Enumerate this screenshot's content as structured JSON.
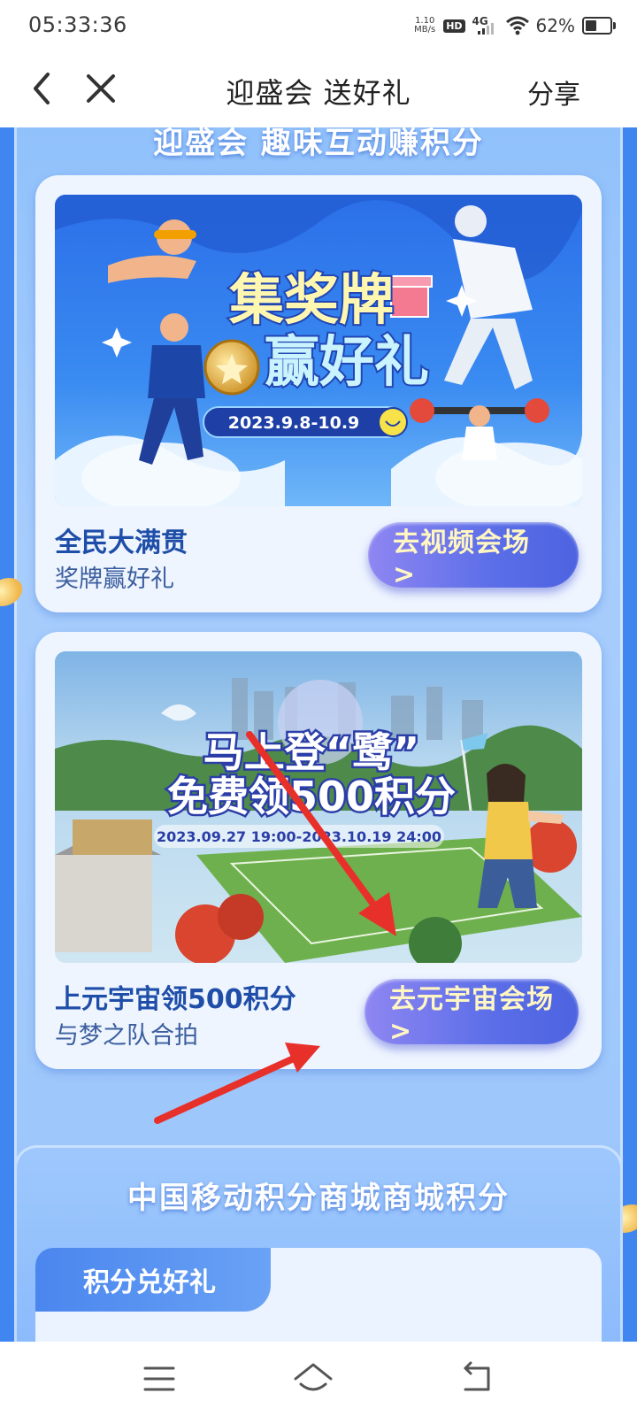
{
  "status_bar": {
    "time": "05:33:36",
    "net_speed_value": "1.10",
    "net_speed_unit": "MB/s",
    "hd_label": "HD",
    "network_label": "4G",
    "battery_percent": "62%",
    "battery_level": 0.62
  },
  "nav": {
    "title": "迎盛会 送好礼",
    "share_label": "分享"
  },
  "section1": {
    "heading": "迎盛会 趣味互动赚积分",
    "cards": [
      {
        "banner_title_line1": "集奖牌",
        "banner_title_line2": "赢好礼",
        "banner_dates": "2023.9.8-10.9",
        "title": "全民大满贯",
        "subtitle": "奖牌赢好礼",
        "button_label": "去视频会场 >"
      },
      {
        "banner_title_line1": "马上登“鹭”",
        "banner_title_line2": "免费领500积分",
        "banner_dates": "2023.09.27 19:00-2023.10.19 24:00",
        "title": "上元宇宙领500积分",
        "subtitle": "与梦之队合拍",
        "button_label": "去元宇宙会场 >"
      }
    ]
  },
  "section2": {
    "heading": "中国移动积分商城商城积分",
    "tab_label": "积分兑好礼"
  },
  "colors": {
    "page_bg": "#3f86f0",
    "button_text": "#fff6c2",
    "card_title": "#1f4ea8",
    "annotation_arrow": "#e8302a"
  }
}
